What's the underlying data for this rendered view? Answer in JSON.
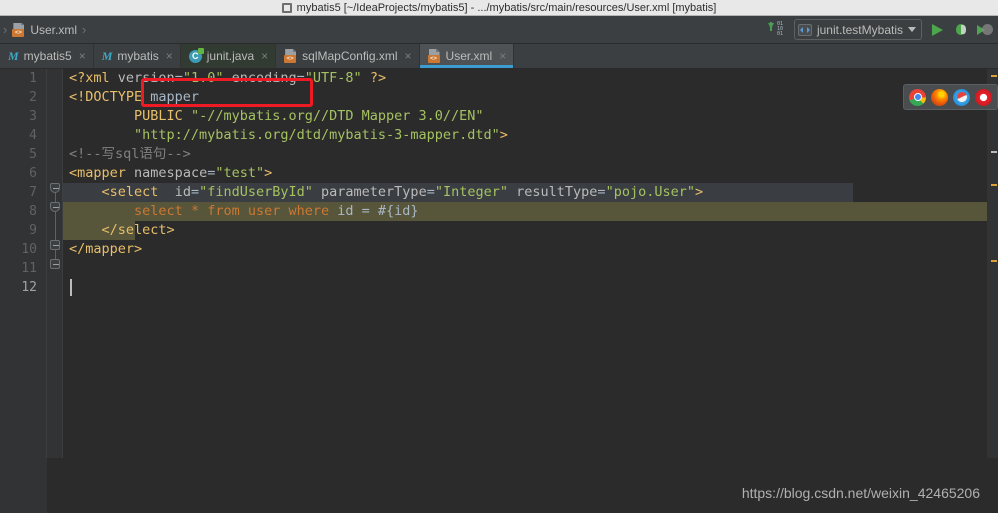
{
  "window": {
    "title": "mybatis5 [~/IdeaProjects/mybatis5] - .../mybatis/src/main/resources/User.xml [mybatis]",
    "app_icon": "idea-icon"
  },
  "navbar": {
    "breadcrumb": [
      {
        "label": "User.xml",
        "icon": "xml-file-icon"
      }
    ],
    "separator": "›",
    "sort_icon": "sort-numeric-icon",
    "sort_digits_top": "01",
    "sort_digits_mid": "10",
    "sort_digits_bottom": "01",
    "run_config": {
      "label": "junit.testMybatis",
      "icon": "run-config-icon",
      "caret": "chevron-down-icon"
    },
    "run_button": "run-icon",
    "debug_button": "debug-icon",
    "coverage_button": "run-with-coverage-icon"
  },
  "tabs": [
    {
      "label": "mybatis5",
      "icon": "maven-module-icon",
      "close": "×",
      "active": false,
      "style": "normal"
    },
    {
      "label": "mybatis",
      "icon": "maven-module-icon",
      "close": "×",
      "active": false,
      "style": "normal"
    },
    {
      "label": "junit.java",
      "icon": "java-class-icon",
      "close": "×",
      "active": false,
      "style": "dark"
    },
    {
      "label": "sqlMapConfig.xml",
      "icon": "xml-file-icon",
      "close": "×",
      "active": false,
      "style": "normal"
    },
    {
      "label": "User.xml",
      "icon": "xml-file-icon",
      "close": "×",
      "active": true,
      "style": "normal"
    }
  ],
  "editor": {
    "line_numbers": [
      "1",
      "2",
      "3",
      "4",
      "5",
      "6",
      "7",
      "8",
      "9",
      "10",
      "11",
      "12"
    ],
    "current_line": 12,
    "lines": [
      {
        "n": 1,
        "tokens": [
          {
            "t": "<?xml ",
            "c": "k-tag"
          },
          {
            "t": "version",
            "c": "k-attr"
          },
          {
            "t": "=",
            "c": "k-plain"
          },
          {
            "t": "\"1.0\"",
            "c": "k-str"
          },
          {
            "t": " ",
            "c": "k-plain"
          },
          {
            "t": "encoding",
            "c": "k-attr"
          },
          {
            "t": "=",
            "c": "k-plain"
          },
          {
            "t": "\"UTF-8\"",
            "c": "k-str"
          },
          {
            "t": " ",
            "c": "k-plain"
          },
          {
            "t": "?>",
            "c": "k-tag"
          }
        ]
      },
      {
        "n": 2,
        "tokens": [
          {
            "t": "<!DOCTYPE ",
            "c": "k-tag"
          },
          {
            "t": "mapper",
            "c": "k-plain"
          }
        ]
      },
      {
        "n": 3,
        "tokens": [
          {
            "t": "        ",
            "c": "k-plain"
          },
          {
            "t": "PUBLIC ",
            "c": "k-tag"
          },
          {
            "t": "\"-//mybatis.org//DTD Mapper 3.0//EN\"",
            "c": "k-str"
          }
        ]
      },
      {
        "n": 4,
        "tokens": [
          {
            "t": "        ",
            "c": "k-plain"
          },
          {
            "t": "\"http://mybatis.org/dtd/mybatis-3-mapper.dtd\"",
            "c": "k-str"
          },
          {
            "t": ">",
            "c": "k-tag"
          }
        ]
      },
      {
        "n": 5,
        "tokens": [
          {
            "t": "<!--写sql语句-->",
            "c": "k-comment"
          }
        ]
      },
      {
        "n": 6,
        "tokens": [
          {
            "t": "<mapper",
            "c": "k-tag"
          },
          {
            "t": " ",
            "c": "k-plain"
          },
          {
            "t": "namespace",
            "c": "k-attr"
          },
          {
            "t": "=",
            "c": "k-plain"
          },
          {
            "t": "\"test\"",
            "c": "k-str"
          },
          {
            "t": ">",
            "c": "k-tag"
          }
        ]
      },
      {
        "n": 7,
        "tokens": [
          {
            "t": "    ",
            "c": "k-plain"
          },
          {
            "t": "<select ",
            "c": "k-tag"
          },
          {
            "t": " ",
            "c": "k-plain"
          },
          {
            "t": "id",
            "c": "k-attr"
          },
          {
            "t": "=",
            "c": "k-plain"
          },
          {
            "t": "\"findUserById\"",
            "c": "k-str"
          },
          {
            "t": " ",
            "c": "k-plain"
          },
          {
            "t": "parameterType",
            "c": "k-attr"
          },
          {
            "t": "=",
            "c": "k-plain"
          },
          {
            "t": "\"Integer\"",
            "c": "k-str"
          },
          {
            "t": " ",
            "c": "k-plain"
          },
          {
            "t": "resultType",
            "c": "k-attr"
          },
          {
            "t": "=",
            "c": "k-plain"
          },
          {
            "t": "\"pojo.User\"",
            "c": "k-str"
          },
          {
            "t": ">",
            "c": "k-tag"
          }
        ]
      },
      {
        "n": 8,
        "tokens": [
          {
            "t": "        ",
            "c": "k-plain"
          },
          {
            "t": "select ",
            "c": "k-sql"
          },
          {
            "t": "* ",
            "c": "k-sql"
          },
          {
            "t": "from ",
            "c": "k-sql"
          },
          {
            "t": "user ",
            "c": "k-sql"
          },
          {
            "t": "where ",
            "c": "k-sql"
          },
          {
            "t": "id ",
            "c": "k-plain"
          },
          {
            "t": "= ",
            "c": "k-plain"
          },
          {
            "t": "#{id}",
            "c": "k-plain"
          }
        ]
      },
      {
        "n": 9,
        "tokens": [
          {
            "t": "    ",
            "c": "k-plain"
          },
          {
            "t": "</select>",
            "c": "k-tag"
          }
        ]
      },
      {
        "n": 10,
        "tokens": [
          {
            "t": "</mapper>",
            "c": "k-tag"
          }
        ]
      },
      {
        "n": 11,
        "tokens": []
      },
      {
        "n": 12,
        "tokens": []
      }
    ],
    "annotation": {
      "type": "red-rectangle",
      "color": "#ee1b24",
      "target_text": "namespace=\"test\""
    },
    "highlights": {
      "selected_line": 7,
      "selection_color": "#3a3d41",
      "sql_block_line": 8,
      "sql_block_color": "#57553a"
    }
  },
  "web_preview": {
    "browsers": [
      "chrome-icon",
      "firefox-icon",
      "safari-icon",
      "opera-icon"
    ]
  },
  "watermark": {
    "text": "https://blog.csdn.net/weixin_42465206"
  }
}
